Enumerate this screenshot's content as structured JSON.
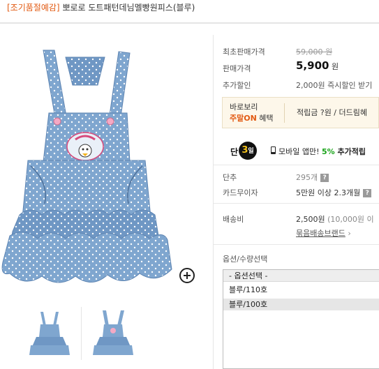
{
  "product": {
    "tag": "[조기품절예감]",
    "name": "뽀로로 도트패턴데님멜빵원피스(블루)"
  },
  "price": {
    "original_label": "최초판매가격",
    "original_value": "59,000 원",
    "sale_label": "판매가격",
    "sale_value": "5,900",
    "sale_unit": "원",
    "discount_label": "추가할인",
    "discount_value": "2,000원 즉시할인 받기"
  },
  "promo": {
    "line1": "바로보리",
    "line2_highlight": "주말ON",
    "line2_rest": " 혜택",
    "right_text": "적립금 ?원 / 더드림혜"
  },
  "event": {
    "dan": "단",
    "badge_num": "3",
    "badge_unit": "일",
    "text_pre": "모바일 앱만! ",
    "pct": "5%",
    "text_post": " 추가적립"
  },
  "info": {
    "sold_label": "단추",
    "sold_value": "295개",
    "card_label": "카드무이자",
    "card_value": "5만원 이상 2.3개월",
    "shipping_label": "배송비",
    "shipping_value": "2,500원",
    "shipping_note": "(10,000원 이",
    "bundle_link": "묶음배송브랜드",
    "bundle_arrow": "›"
  },
  "options": {
    "title": "옵션/수량선택",
    "header": "- 옵션선택 -",
    "items": [
      "블루/110호",
      "블루/100호"
    ]
  },
  "colors": {
    "accent": "#e25a12",
    "green": "#19a319"
  }
}
